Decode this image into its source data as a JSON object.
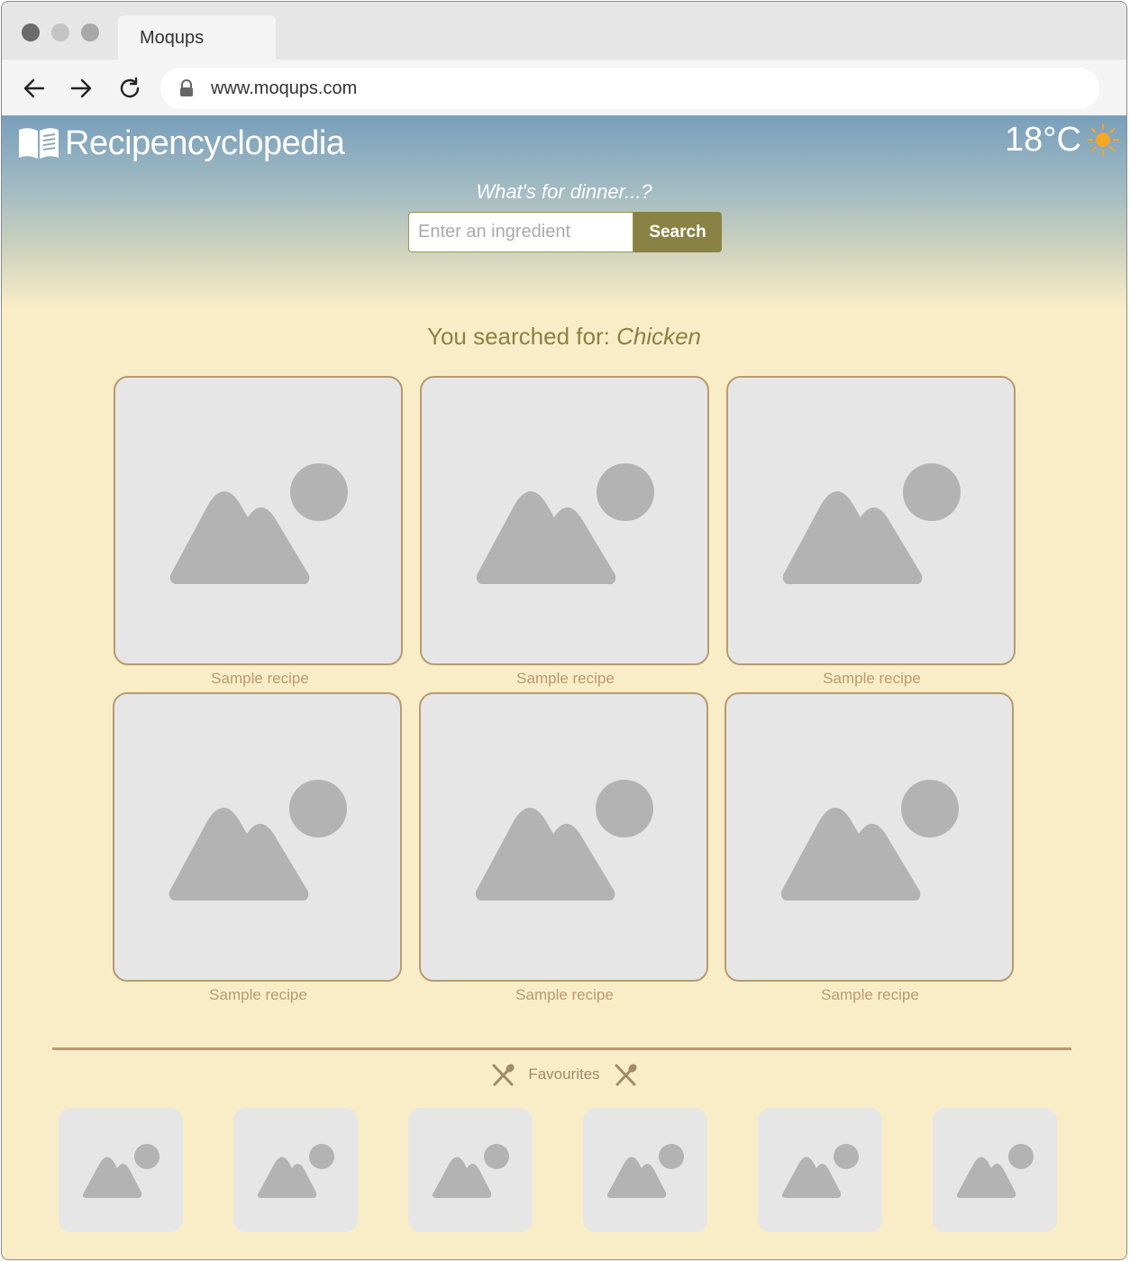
{
  "browser": {
    "tab_title": "Moqups",
    "url": "www.moqups.com"
  },
  "header": {
    "brand": "Recipencyclopedia",
    "temperature": "18°C",
    "tagline": "What's for dinner...?",
    "search_placeholder": "Enter an ingredient",
    "search_button": "Search"
  },
  "results": {
    "prefix": "You searched for:",
    "query": "Chicken",
    "recipes": [
      {
        "label": "Sample recipe"
      },
      {
        "label": "Sample recipe"
      },
      {
        "label": "Sample recipe"
      },
      {
        "label": "Sample recipe"
      },
      {
        "label": "Sample recipe"
      },
      {
        "label": "Sample recipe"
      }
    ]
  },
  "favourites": {
    "title": "Favourites",
    "count": 6
  },
  "colors": {
    "accent": "#8a8244",
    "border_tan": "#b99a6f",
    "background": "#f9edc8",
    "sun": "#f5a623"
  },
  "icons": [
    "back-arrow-icon",
    "forward-arrow-icon",
    "reload-icon",
    "lock-icon",
    "book-icon",
    "sun-icon",
    "image-placeholder-icon",
    "utensils-icon"
  ]
}
